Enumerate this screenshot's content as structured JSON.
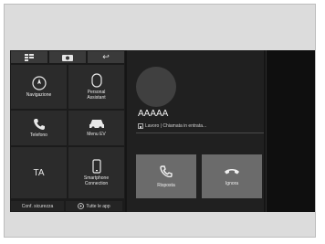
{
  "top_buttons": [
    {
      "icon": "menu-list-icon"
    },
    {
      "icon": "camera-icon"
    },
    {
      "icon": "back-icon",
      "label": "↩"
    }
  ],
  "tiles": [
    {
      "label": "Navigazione",
      "icon": "compass-icon"
    },
    {
      "label": "Personal\nAssistant",
      "icon": "assistant-icon"
    },
    {
      "label": "Telefono",
      "icon": "phone-icon"
    },
    {
      "label": "Menu EV",
      "icon": "ev-car-icon"
    },
    {
      "label": "Smartphone\nConnection",
      "icon": "smartphone-icon"
    }
  ],
  "ta_label": "TA",
  "bottom": {
    "left_label": "Conf. sicurezza",
    "right_label": "Tutte le app"
  },
  "call": {
    "caller_name": "AAAAA",
    "caller_sub": "Lavoro | Chiamata in entrata...",
    "answer_label": "Risposta",
    "decline_label": "Ignora"
  }
}
